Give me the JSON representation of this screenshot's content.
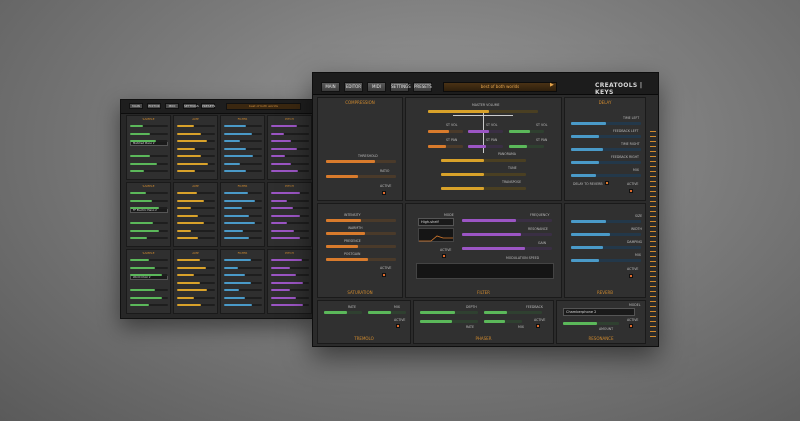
{
  "back_window": {
    "nav": [
      "MAIN",
      "EDITOR",
      "MIDI",
      "SETTINGS",
      "PRESETS"
    ],
    "preset_name": "best of both worlds",
    "dropdowns": [
      "Matched Piano 2",
      "FF Electric Piano 2",
      "World Choir 2"
    ],
    "section_headers": [
      "SAMPLE",
      "AMP",
      "FILTER",
      "PITCH"
    ]
  },
  "main_window": {
    "nav": [
      "MAIN",
      "EDITOR",
      "MIDI",
      "SETTINGS",
      "PRESETS"
    ],
    "preset_name": "best of both worlds",
    "brand": "CREATOOLS | KEYS",
    "compression": {
      "title": "COMPRESSION",
      "labels": [
        "THRESHOLD",
        "RATIO",
        "ACTIVE"
      ]
    },
    "mixer": {
      "labels": [
        "MASTER VOLUME",
        "ST VOL",
        "ST VOL",
        "ST VOL",
        "ST PAN",
        "ST PAN",
        "ST PAN",
        "PANORAMA",
        "TUNE",
        "TRANSPOSE"
      ]
    },
    "delay": {
      "title": "DELAY",
      "labels": [
        "TIME LEFT",
        "FEEDBACK LEFT",
        "TIME RIGHT",
        "FEEDBACK RIGHT",
        "MIX",
        "DELAY TO REVERB",
        "ACTIVE"
      ]
    },
    "saturation": {
      "title": "SATURATION",
      "labels": [
        "INTENSITY",
        "WARMTH",
        "PRESENCE",
        "POSTGAIN",
        "ACTIVE"
      ]
    },
    "filter": {
      "title": "FILTER",
      "mode_label": "MODE",
      "mode_value": "High-shelf",
      "labels": [
        "FREQUENCY",
        "RESONANCE",
        "GAIN",
        "MODULATION SPEED",
        "ACTIVE"
      ]
    },
    "reverb": {
      "title": "REVERB",
      "labels": [
        "SIZE",
        "WIDTH",
        "DAMPING",
        "MIX",
        "ACTIVE"
      ]
    },
    "tremolo": {
      "title": "TREMOLO",
      "labels": [
        "RATE",
        "MIX",
        "ACTIVE"
      ]
    },
    "phaser": {
      "title": "PHASER",
      "labels": [
        "DEPTH",
        "FEEDBACK",
        "RATE",
        "MIX",
        "ACTIVE"
      ]
    },
    "resonance": {
      "title": "RESONANCE",
      "model_label": "MODEL",
      "model_value": "Chamberphone 2",
      "labels": [
        "AMOUNT",
        "ACTIVE"
      ]
    }
  },
  "colors": {
    "orange": "#d97b2c",
    "yellow": "#d9a22a",
    "purple": "#9b55c4",
    "blue": "#4a9ac8",
    "green": "#5bb85a",
    "header": "#d08a2e"
  }
}
